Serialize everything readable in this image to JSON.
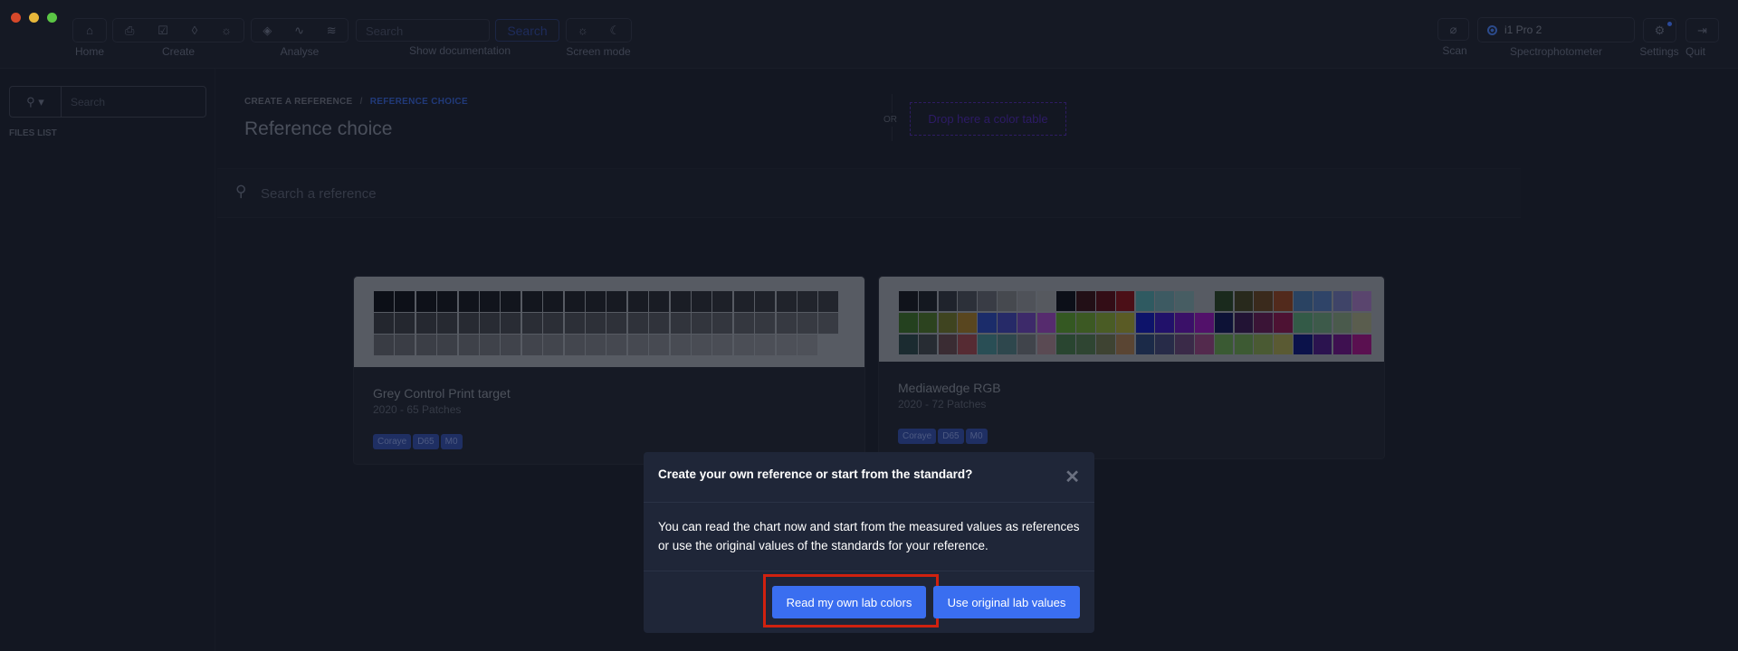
{
  "window": {
    "controls": [
      "close",
      "minimize",
      "maximize"
    ],
    "control_colors": [
      "#d6482a",
      "#e7b73a",
      "#5bc645"
    ]
  },
  "toolbar": {
    "home_label": "Home",
    "create_label": "Create",
    "analyse_label": "Analyse",
    "doc_search_placeholder": "Search",
    "doc_search_button": "Search",
    "doc_label": "Show documentation",
    "screen_mode_label": "Screen mode",
    "scan_label": "Scan",
    "device_value": "i1 Pro 2",
    "device_label": "Spectrophotometer",
    "settings_label": "Settings",
    "quit_label": "Quit"
  },
  "sidebar": {
    "search_placeholder": "Search",
    "files_list_label": "FILES LIST"
  },
  "main": {
    "breadcrumb": [
      "CREATE A REFERENCE",
      "REFERENCE CHOICE"
    ],
    "breadcrumb_separator": "/",
    "title": "Reference choice",
    "or_label": "OR",
    "drop_label": "Drop here a color table",
    "search_placeholder": "Search a reference",
    "cards": [
      {
        "title": "Grey Control Print target",
        "subtitle": "2020 - 65 Patches",
        "tags": [
          "Coraye",
          "D65",
          "M0"
        ]
      },
      {
        "title": "Mediawedge RGB",
        "subtitle": "2020 - 72 Patches",
        "tags": [
          "Coraye",
          "D65",
          "M0"
        ]
      }
    ]
  },
  "mediawedge_patch_colors": [
    [
      "#10131b",
      "#141820",
      "#1f232c",
      "#2c3039",
      "#393c45",
      "#46494f",
      "#4f5259",
      "#56595f",
      "#0c0f18",
      "#220f16",
      "#330d16",
      "#4b0f17",
      "#2f5a61",
      "#3d5a62",
      "#475d63",
      "#575b63",
      "#1a2a1d",
      "#28291c",
      "#3a2a1c",
      "#522a1c",
      "#2a4362",
      "#2f4468",
      "#3f4468",
      "#5a456e"
    ],
    [
      "#24411f",
      "#2c431f",
      "#3f4420",
      "#59461f",
      "#1b2c6a",
      "#262a68",
      "#3d2a6a",
      "#562b6e",
      "#345822",
      "#3c5923",
      "#4a5c25",
      "#5a5b25",
      "#0d136a",
      "#21116a",
      "#3a1068",
      "#52116a",
      "#0d1236",
      "#221334",
      "#3a1436",
      "#4d1233",
      "#335a47",
      "#3d5a4a",
      "#4a5a4c",
      "#5a5d4e"
    ],
    [
      "#1b2b30",
      "#272c33",
      "#3a2c33",
      "#562b33",
      "#294e55",
      "#2e474d",
      "#40444b",
      "#5a4a53",
      "#294530",
      "#2f4532",
      "#3e4332",
      "#5a4533",
      "#1b2a48",
      "#272b48",
      "#3a2a48",
      "#532a4d",
      "#3a5a33",
      "#3d5a33",
      "#4a5a33",
      "#5a5a33",
      "#0b124a",
      "#2b134f",
      "#3e1050",
      "#5a1050"
    ]
  ],
  "dialog": {
    "title": "Create your own reference or start from the standard?",
    "body": "You can read the chart now and start from the measured values as references or use the original values of the standards for your reference.",
    "primary_button": "Read my own lab colors",
    "secondary_button": "Use original lab values",
    "highlight_color": "#d0210f"
  },
  "colors": {
    "accent": "#3a6ef0",
    "background": "#131722"
  }
}
